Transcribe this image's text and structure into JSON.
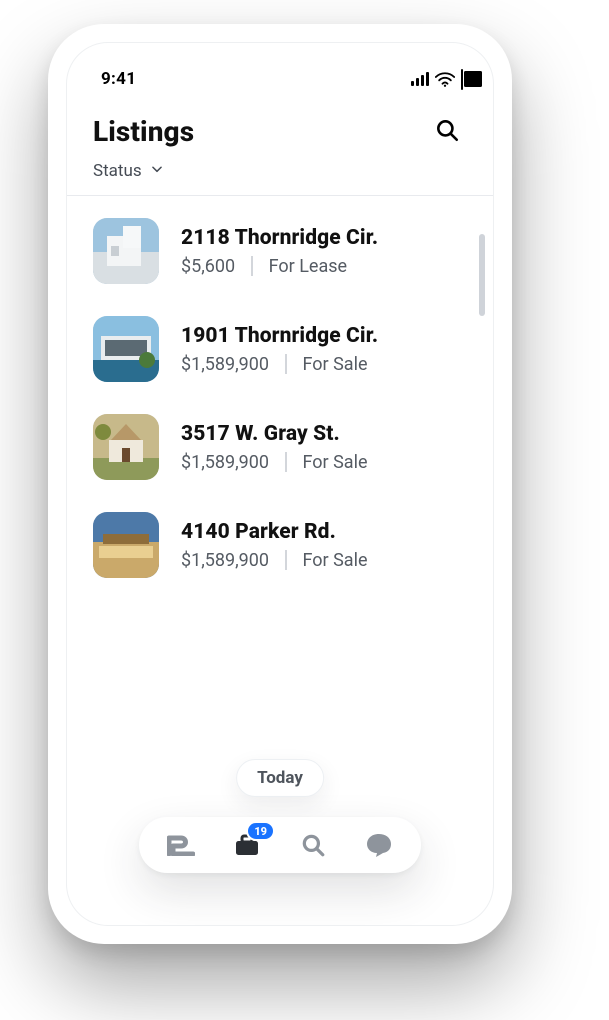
{
  "statusbar": {
    "time": "9:41"
  },
  "header": {
    "title": "Listings"
  },
  "filters": {
    "status_label": "Status"
  },
  "floating_label": "Today",
  "navbar": {
    "badge": "19"
  },
  "listings": [
    {
      "address": "2118 Thornridge Cir.",
      "price": "$5,600",
      "status": "For Lease"
    },
    {
      "address": "1901 Thornridge Cir.",
      "price": "$1,589,900",
      "status": "For Sale"
    },
    {
      "address": "3517 W. Gray St.",
      "price": "$1,589,900",
      "status": "For Sale"
    },
    {
      "address": "4140 Parker Rd.",
      "price": "$1,589,900",
      "status": "For Sale"
    }
  ]
}
